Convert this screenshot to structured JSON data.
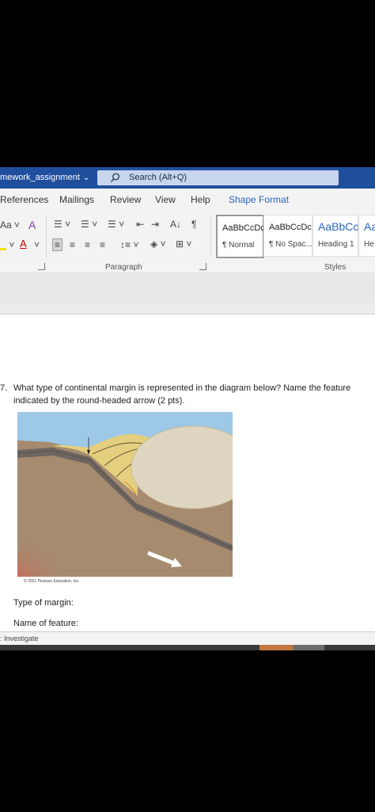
{
  "title_bar": {
    "document_name": "mework_assignment",
    "search_placeholder": "Search (Alt+Q)"
  },
  "ribbon_tabs": [
    "References",
    "Mailings",
    "Review",
    "View",
    "Help",
    "Shape Format"
  ],
  "active_tab": "Shape Format",
  "ribbon": {
    "font_glyphs": {
      "grow_font": "Aa",
      "clear_format": "A",
      "font_color": "A"
    },
    "paragraph_group_label": "Paragraph",
    "styles_group_label": "Styles",
    "styles": [
      {
        "sample": "AaBbCcDc",
        "name": "¶ Normal"
      },
      {
        "sample": "AaBbCcDc",
        "name": "¶ No Spac..."
      },
      {
        "sample": "AaBbCc",
        "name": "Heading 1"
      },
      {
        "sample": "Aa",
        "name": "He"
      }
    ],
    "pilcrow": "¶"
  },
  "document": {
    "question_number": "7.",
    "question_line1": "What type of continental margin is represented in the diagram below? Name the feature",
    "question_line2": "indicated by the round-headed arrow (2 pts).",
    "figure_copyright": "© 2021 Pearson Education, Inc.",
    "type_of_margin_label": "Type of margin:",
    "name_of_feature_label": "Name of feature:"
  },
  "status_bar": {
    "text": ": Investigate"
  },
  "colors": {
    "title_bar": "#1f4e9c",
    "accent": "#2b66b8",
    "sky": "#9dc8e6",
    "crust": "#a68b6f",
    "sediment": "#e3cf7e"
  }
}
